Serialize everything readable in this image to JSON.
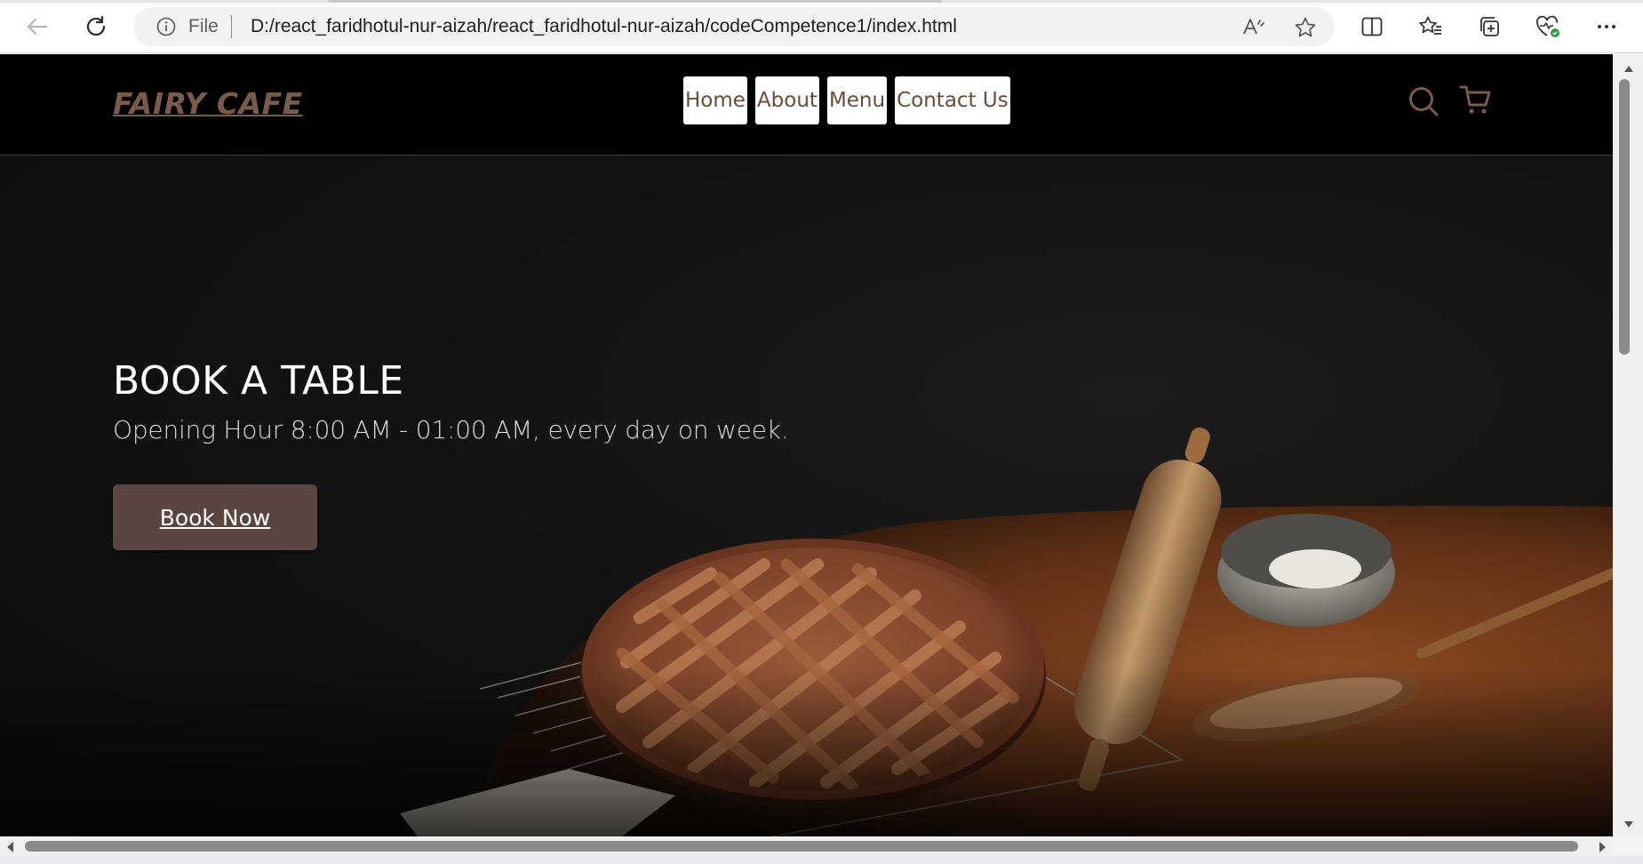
{
  "browser": {
    "file_label": "File",
    "url": "D:/react_faridhotul-nur-aizah/react_faridhotul-nur-aizah/codeCompetence1/index.html",
    "icons": [
      "back-icon",
      "refresh-icon",
      "info-icon",
      "read-aloud-icon",
      "favorite-star-icon",
      "split-screen-icon",
      "favorites-icon",
      "collections-icon",
      "browser-essentials-icon",
      "more-icon"
    ]
  },
  "site": {
    "logo": "FAIRY CAFE",
    "nav": [
      "Home",
      "About",
      "Menu",
      "Contact Us"
    ],
    "header_icons": [
      "search-icon",
      "cart-icon"
    ],
    "accent_color": "#7a5a49"
  },
  "hero": {
    "title": "BOOK A TABLE",
    "subtitle": "Opening Hour 8:00 AM - 01:00 AM, every day on week.",
    "button": "Book Now",
    "button_color": "#5a4540"
  }
}
